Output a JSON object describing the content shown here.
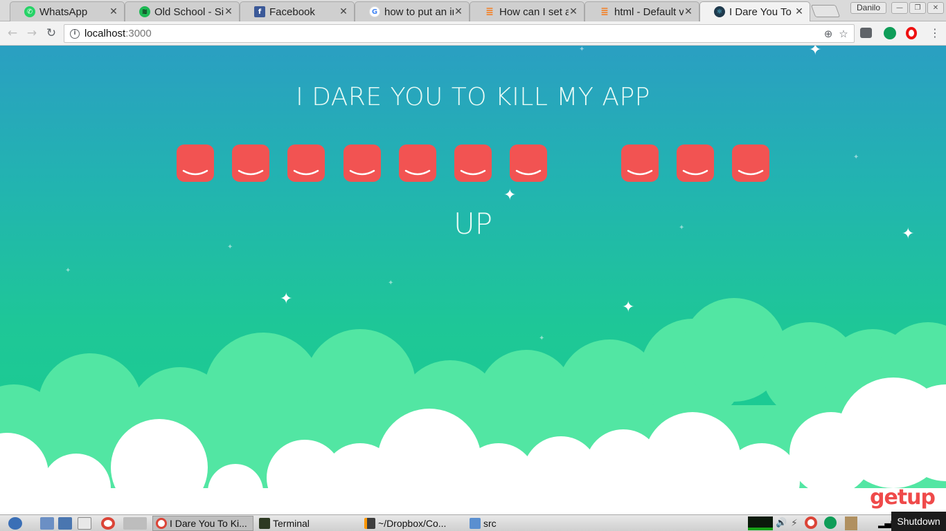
{
  "browser": {
    "tabs": [
      {
        "title": "WhatsApp",
        "icon": "whatsapp-icon",
        "color": "#25d366"
      },
      {
        "title": "Old School - Sik",
        "icon": "spotify-icon",
        "color": "#1db954"
      },
      {
        "title": "Facebook",
        "icon": "facebook-icon",
        "color": "#3b5998"
      },
      {
        "title": "how to put an im",
        "icon": "google-icon",
        "color": "#4285f4"
      },
      {
        "title": "How can I set a",
        "icon": "stackoverflow-icon",
        "color": "#f48024"
      },
      {
        "title": "html - Default v",
        "icon": "stackoverflow-icon",
        "color": "#f48024"
      },
      {
        "title": "I Dare You To Ki",
        "icon": "react-icon",
        "color": "#1f3a4d"
      }
    ],
    "user": "Danilo",
    "url_host": "localhost",
    "url_port": ":3000"
  },
  "app": {
    "title": "I DARE YOU TO KILL MY APP",
    "status": "UP",
    "face_color": "#f25352",
    "faces_visible": [
      true,
      true,
      true,
      true,
      true,
      true,
      true,
      false,
      true,
      true,
      true
    ]
  },
  "watermark": "getup",
  "taskbar": {
    "tasks": [
      {
        "label": "I Dare You To Ki...",
        "icon": "chrome-icon",
        "active": true
      },
      {
        "label": "Terminal",
        "icon": "terminal-icon",
        "active": false
      },
      {
        "label": "~/Dropbox/Co...",
        "icon": "sublime-icon",
        "active": false
      },
      {
        "label": "src",
        "icon": "folder-icon",
        "active": false
      }
    ],
    "tooltip": "Shutdown"
  }
}
